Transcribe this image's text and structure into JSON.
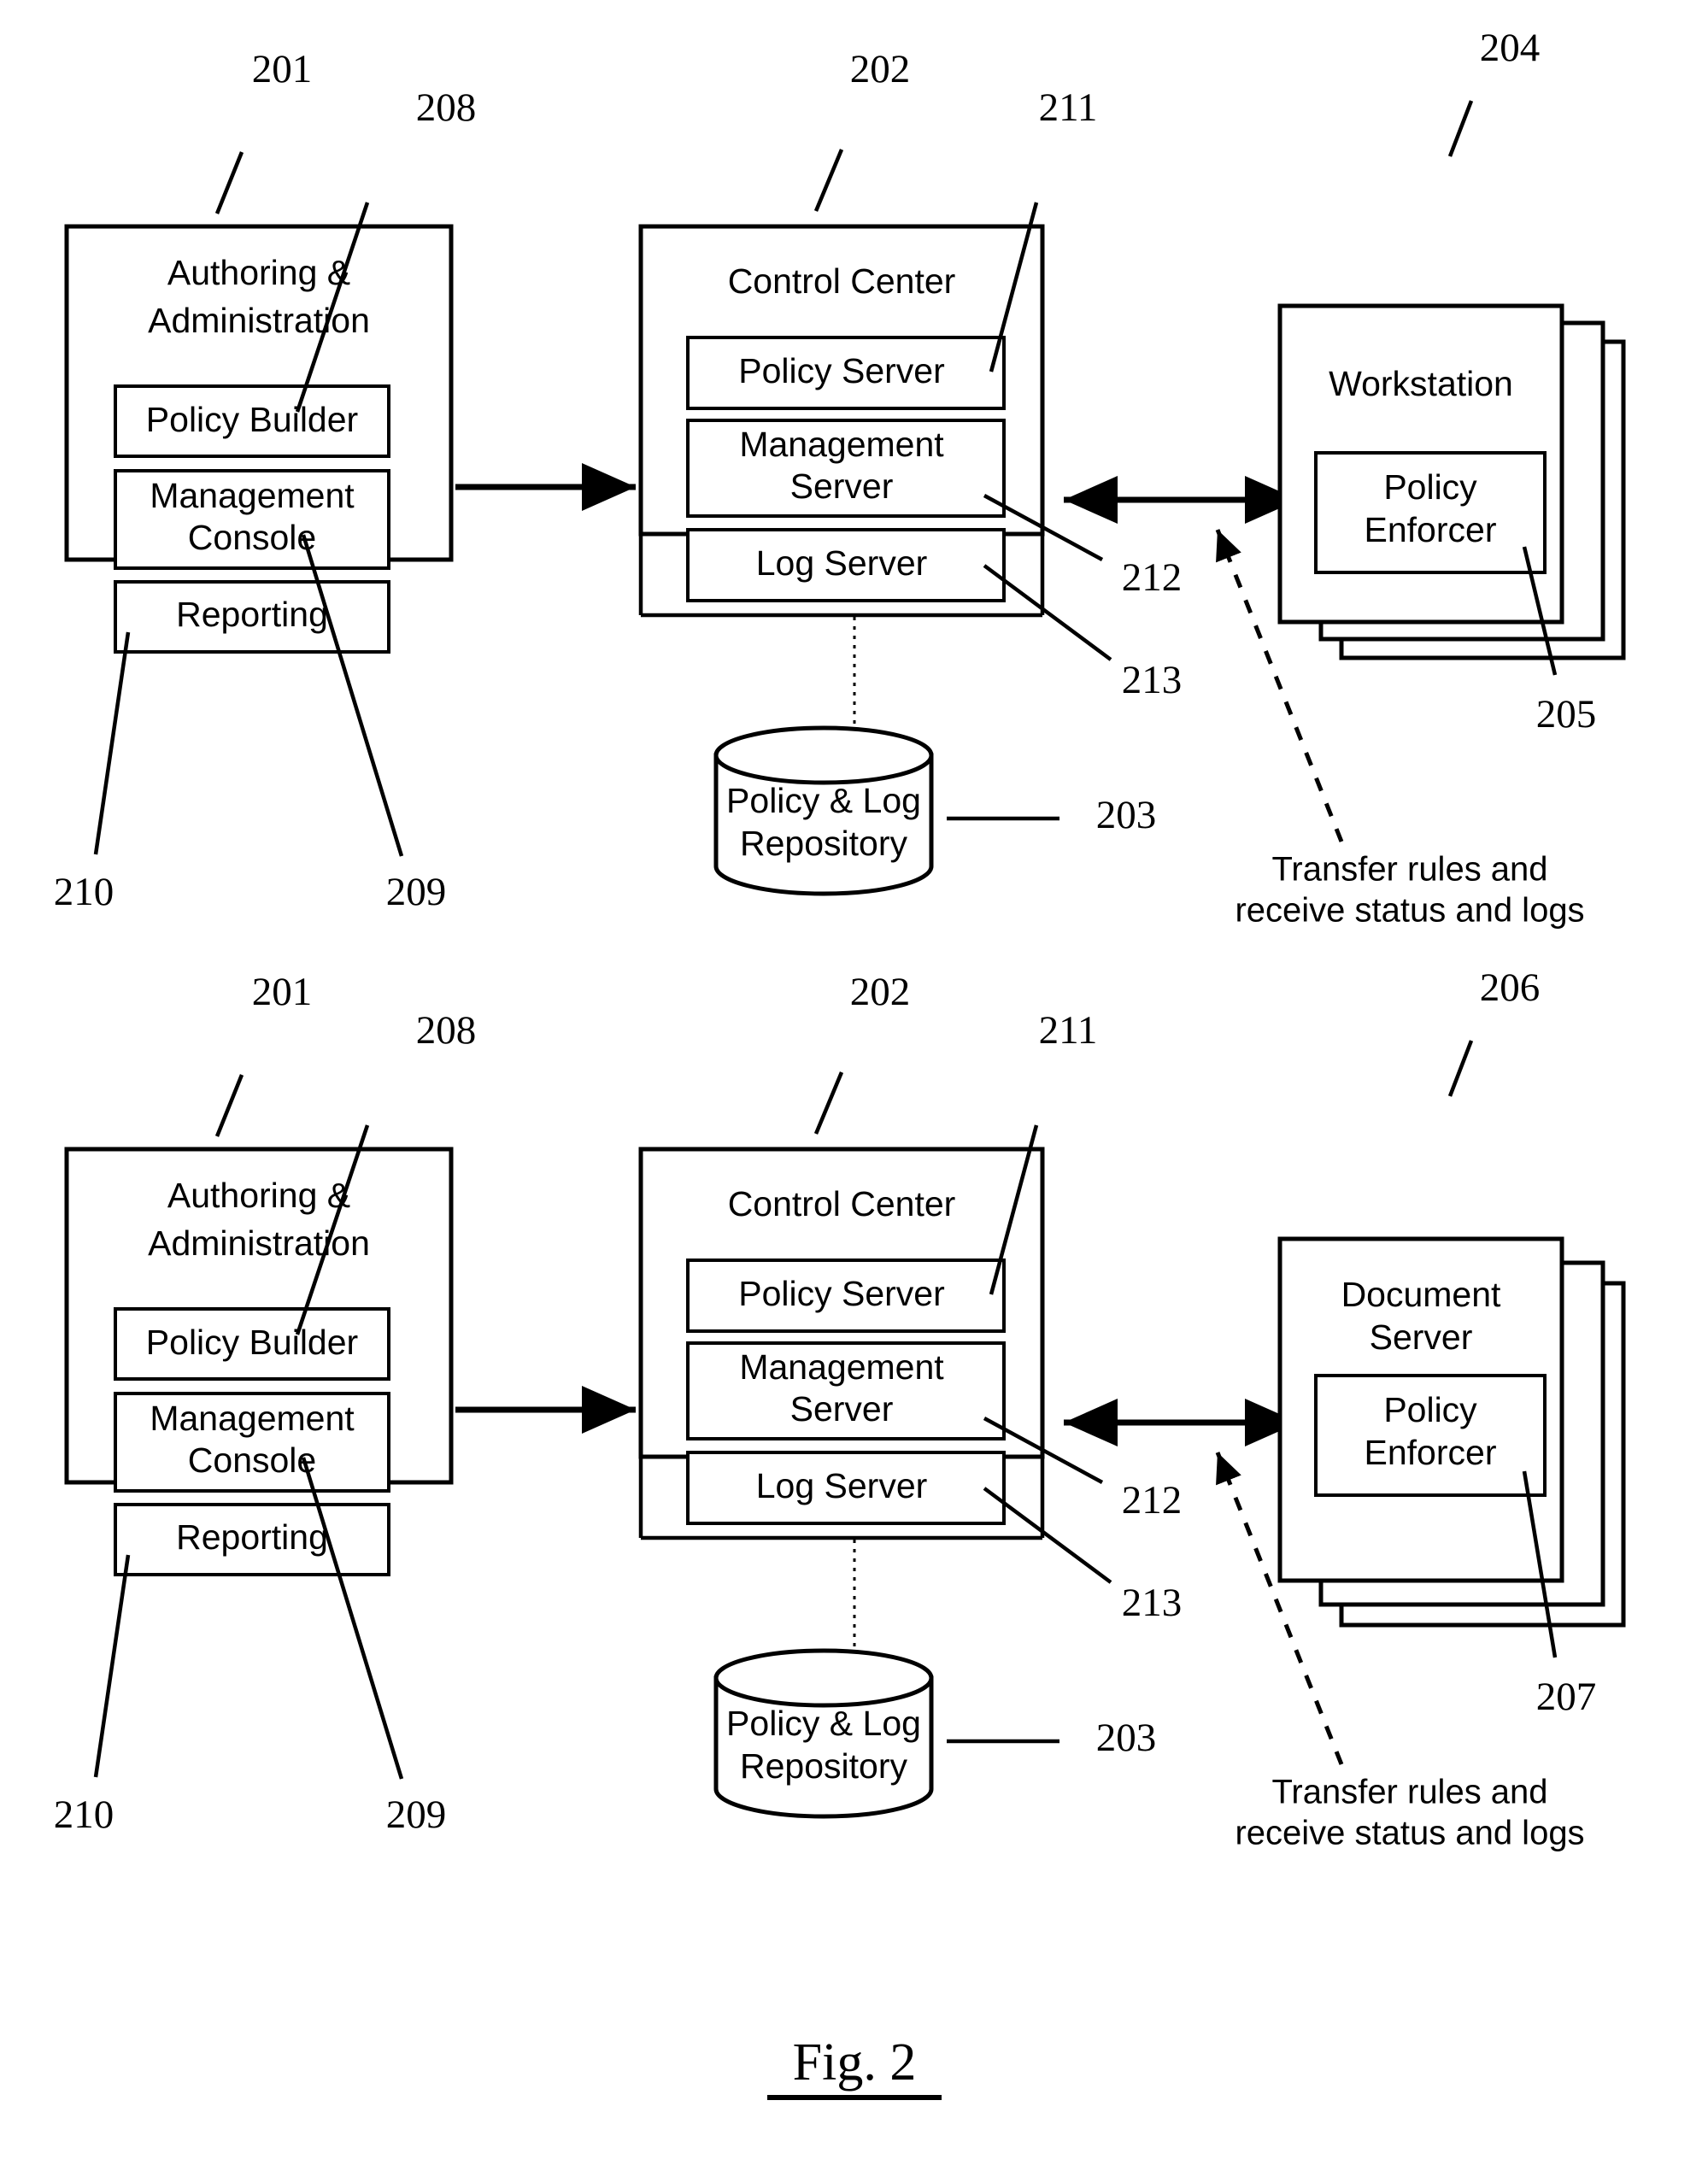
{
  "figure": {
    "caption": "Fig. 2",
    "panels": [
      {
        "id": "panel-top",
        "authoring": {
          "title_line1": "Authoring &",
          "title_line2": "Administration",
          "ref": "201",
          "modules": [
            {
              "label": "Policy Builder",
              "ref": "208"
            },
            {
              "label_line1": "Management",
              "label_line2": "Console",
              "ref": "209"
            },
            {
              "label": "Reporting",
              "ref": "210"
            }
          ]
        },
        "control_center": {
          "title": "Control Center",
          "ref": "202",
          "modules": [
            {
              "label": "Policy Server",
              "ref": "211"
            },
            {
              "label_line1": "Management",
              "label_line2": "Server",
              "ref": "212"
            },
            {
              "label": "Log Server",
              "ref": "213"
            }
          ]
        },
        "repository": {
          "label_line1": "Policy & Log",
          "label_line2": "Repository",
          "ref": "203"
        },
        "endpoint": {
          "title_line1": "Workstation",
          "title_line2": "",
          "ref": "204",
          "module": {
            "label_line1": "Policy",
            "label_line2": "Enforcer",
            "ref": "205"
          }
        },
        "annotation": {
          "line1": "Transfer rules and",
          "line2": "receive status and logs"
        }
      },
      {
        "id": "panel-bottom",
        "authoring": {
          "title_line1": "Authoring &",
          "title_line2": "Administration",
          "ref": "201",
          "modules": [
            {
              "label": "Policy Builder",
              "ref": "208"
            },
            {
              "label_line1": "Management",
              "label_line2": "Console",
              "ref": "209"
            },
            {
              "label": "Reporting",
              "ref": "210"
            }
          ]
        },
        "control_center": {
          "title": "Control Center",
          "ref": "202",
          "modules": [
            {
              "label": "Policy Server",
              "ref": "211"
            },
            {
              "label_line1": "Management",
              "label_line2": "Server",
              "ref": "212"
            },
            {
              "label": "Log Server",
              "ref": "213"
            }
          ]
        },
        "repository": {
          "label_line1": "Policy & Log",
          "label_line2": "Repository",
          "ref": "203"
        },
        "endpoint": {
          "title_line1": "Document",
          "title_line2": "Server",
          "ref": "206",
          "module": {
            "label_line1": "Policy",
            "label_line2": "Enforcer",
            "ref": "207"
          }
        },
        "annotation": {
          "line1": "Transfer rules and",
          "line2": "receive status and logs"
        }
      }
    ],
    "colors": {
      "ink": "#000000",
      "paper": "#ffffff"
    }
  }
}
